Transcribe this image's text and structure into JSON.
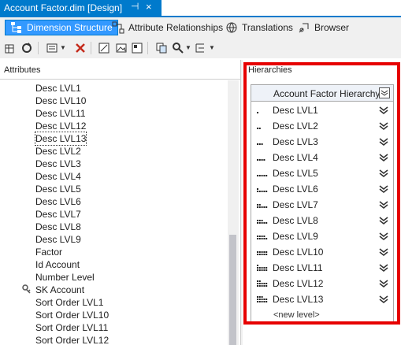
{
  "document": {
    "tab_title": "Account Factor.dim [Design]",
    "pin_glyph": "⊣",
    "close_glyph": "×"
  },
  "view_tabs": [
    {
      "label": "Dimension Structure",
      "icon": "dimension-structure-icon",
      "active": true
    },
    {
      "label": "Attribute Relationships",
      "icon": "attribute-relationships-icon",
      "active": false
    },
    {
      "label": "Translations",
      "icon": "translations-icon",
      "active": false
    },
    {
      "label": "Browser",
      "icon": "browser-icon",
      "active": false
    }
  ],
  "attributes": {
    "header": "Attributes",
    "items": [
      {
        "label": "Desc LVL1",
        "icon": "attribute-icon"
      },
      {
        "label": "Desc LVL10",
        "icon": "attribute-icon"
      },
      {
        "label": "Desc LVL11",
        "icon": "attribute-icon"
      },
      {
        "label": "Desc LVL12",
        "icon": "attribute-icon"
      },
      {
        "label": "Desc LVL13",
        "icon": "attribute-icon",
        "selected": true
      },
      {
        "label": "Desc LVL2",
        "icon": "attribute-icon"
      },
      {
        "label": "Desc LVL3",
        "icon": "attribute-icon"
      },
      {
        "label": "Desc LVL4",
        "icon": "attribute-icon"
      },
      {
        "label": "Desc LVL5",
        "icon": "attribute-icon"
      },
      {
        "label": "Desc LVL6",
        "icon": "attribute-icon"
      },
      {
        "label": "Desc LVL7",
        "icon": "attribute-icon"
      },
      {
        "label": "Desc LVL8",
        "icon": "attribute-icon"
      },
      {
        "label": "Desc LVL9",
        "icon": "attribute-icon"
      },
      {
        "label": "Factor",
        "icon": "attribute-icon"
      },
      {
        "label": "Id Account",
        "icon": "attribute-icon"
      },
      {
        "label": "Number Level",
        "icon": "attribute-icon"
      },
      {
        "label": "SK Account",
        "icon": "key-attribute-icon"
      },
      {
        "label": "Sort Order LVL1",
        "icon": "attribute-icon"
      },
      {
        "label": "Sort Order LVL10",
        "icon": "attribute-icon"
      },
      {
        "label": "Sort Order LVL11",
        "icon": "attribute-icon"
      },
      {
        "label": "Sort Order LVL12",
        "icon": "attribute-icon"
      }
    ]
  },
  "hierarchies": {
    "header": "Hierarchies",
    "hierarchy_name": "Account Factor Hierarchy",
    "levels": [
      {
        "label": "Desc LVL1",
        "dots": 1
      },
      {
        "label": "Desc LVL2",
        "dots": 2
      },
      {
        "label": "Desc LVL3",
        "dots": 3
      },
      {
        "label": "Desc LVL4",
        "dots": 4
      },
      {
        "label": "Desc LVL5",
        "dots": 5
      },
      {
        "label": "Desc LVL6",
        "dots": 6
      },
      {
        "label": "Desc LVL7",
        "dots": 7
      },
      {
        "label": "Desc LVL8",
        "dots": 8
      },
      {
        "label": "Desc LVL9",
        "dots": 9
      },
      {
        "label": "Desc LVL10",
        "dots": 10
      },
      {
        "label": "Desc LVL11",
        "dots": 11
      },
      {
        "label": "Desc LVL12",
        "dots": 12
      },
      {
        "label": "Desc LVL13",
        "dots": 13
      }
    ],
    "new_level": "<new level>"
  },
  "colors": {
    "accent": "#007acc",
    "highlight": "#e60000"
  }
}
